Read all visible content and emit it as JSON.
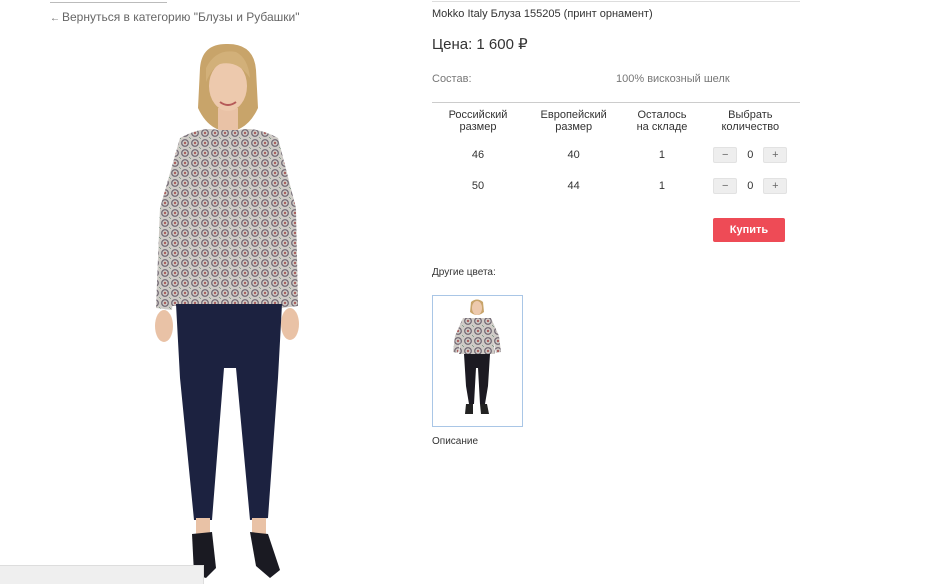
{
  "nav": {
    "back_arrow": "←",
    "back_link_label": "Вернуться в категорию \"Блузы и Рубашки\""
  },
  "product": {
    "title": "Mokko Italy Блуза 155205 (принт орнамент)",
    "price_label": "Цена: 1 600 ₽",
    "composition_label": "Состав:",
    "composition_value": "100% вискозный шелк"
  },
  "size_table": {
    "headers": [
      "Российский\nразмер",
      "Европейский\nразмер",
      "Осталось\nна складе",
      "Выбрать\nколичество"
    ],
    "rows": [
      {
        "ru": "46",
        "eu": "40",
        "stock": "1",
        "qty": "0"
      },
      {
        "ru": "50",
        "eu": "44",
        "stock": "1",
        "qty": "0"
      }
    ],
    "minus_label": "−",
    "plus_label": "+"
  },
  "actions": {
    "buy_label": "Купить"
  },
  "colors": {
    "other_colors_label": "Другие цвета:",
    "description_label": "Описание",
    "accent": "#ee4b56",
    "thumb_border": "#a9c6e6"
  }
}
